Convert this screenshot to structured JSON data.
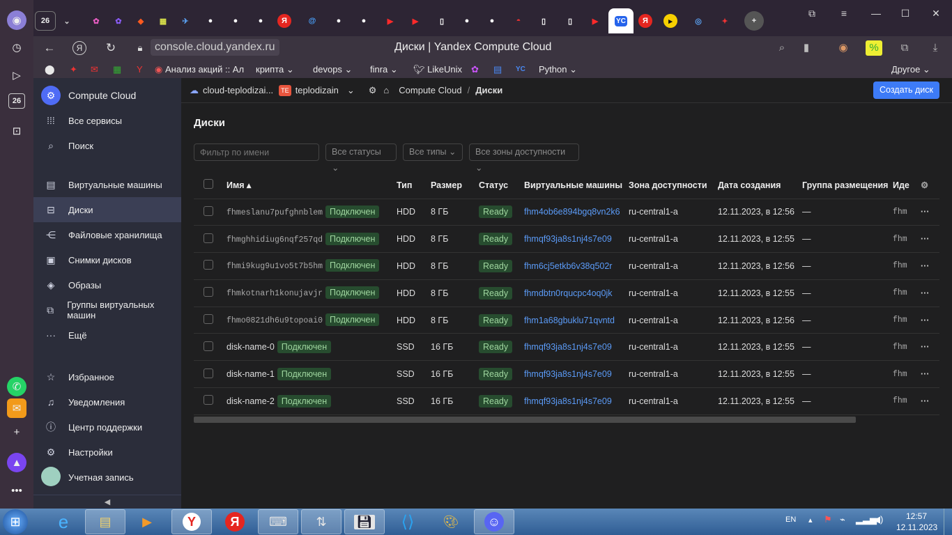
{
  "browser": {
    "tab_count": "26",
    "active_tab_label": "YC",
    "url": "console.cloud.yandex.ru",
    "page_title": "Диски | Yandex Compute Cloud",
    "bookmarks": [
      "Анализ акций :: Ал",
      "крипта",
      "devops",
      "finra",
      "LikeUnix",
      "Python",
      "Другое"
    ]
  },
  "left_strip": {
    "counter": "26"
  },
  "sidebar": {
    "product": "Compute Cloud",
    "all_services": "Все сервисы",
    "search": "Поиск",
    "items": [
      {
        "label": "Виртуальные машины"
      },
      {
        "label": "Диски"
      },
      {
        "label": "Файловые хранилища"
      },
      {
        "label": "Снимки дисков"
      },
      {
        "label": "Образы"
      },
      {
        "label": "Группы виртуальных машин"
      },
      {
        "label": "Ещё"
      }
    ],
    "bottom": [
      {
        "label": "Избранное"
      },
      {
        "label": "Уведомления"
      },
      {
        "label": "Центр поддержки"
      },
      {
        "label": "Настройки"
      },
      {
        "label": "Учетная запись"
      }
    ],
    "collapse": "◀"
  },
  "breadcrumbs": {
    "cloud": "cloud-teplodizai...",
    "folder_badge": "TE",
    "folder": "teplodizain",
    "service": "Compute Cloud",
    "sep": "/",
    "page": "Диски"
  },
  "create_button": "Создать диск",
  "page_heading": "Диски",
  "filters": {
    "name_placeholder": "Фильтр по имени",
    "statuses": "Все статусы",
    "types": "Все типы",
    "zones": "Все зоны доступности"
  },
  "table": {
    "columns": [
      "Имя ▴",
      "Тип",
      "Размер",
      "Статус",
      "Виртуальные машины",
      "Зона доступности",
      "Дата создания",
      "Группа размещения",
      "Иде"
    ],
    "rows": [
      {
        "name": "fhmeslanu7pufghnblem",
        "mono": true,
        "attached": "Подключен",
        "type": "HDD",
        "size": "8 ГБ",
        "status": "Ready",
        "vm": "fhm4ob6e894bgq8vn2k6",
        "zone": "ru-central1-a",
        "created": "12.11.2023, в 12:56",
        "group": "—",
        "id": "fhm"
      },
      {
        "name": "fhmghhidiug6nqf257qd",
        "mono": true,
        "attached": "Подключен",
        "type": "HDD",
        "size": "8 ГБ",
        "status": "Ready",
        "vm": "fhmqf93ja8s1nj4s7e09",
        "zone": "ru-central1-a",
        "created": "12.11.2023, в 12:55",
        "group": "—",
        "id": "fhm"
      },
      {
        "name": "fhmi9kug9u1vo5t7b5hm",
        "mono": true,
        "attached": "Подключен",
        "type": "HDD",
        "size": "8 ГБ",
        "status": "Ready",
        "vm": "fhm6cj5etkb6v38q502r",
        "zone": "ru-central1-a",
        "created": "12.11.2023, в 12:56",
        "group": "—",
        "id": "fhm"
      },
      {
        "name": "fhmkotnarh1konujavjr",
        "mono": true,
        "attached": "Подключен",
        "type": "HDD",
        "size": "8 ГБ",
        "status": "Ready",
        "vm": "fhmdbtn0rqucpc4oq0jk",
        "zone": "ru-central1-a",
        "created": "12.11.2023, в 12:55",
        "group": "—",
        "id": "fhm"
      },
      {
        "name": "fhmo0821dh6u9topoai0",
        "mono": true,
        "attached": "Подключен",
        "type": "HDD",
        "size": "8 ГБ",
        "status": "Ready",
        "vm": "fhm1a68gbuklu71qvntd",
        "zone": "ru-central1-a",
        "created": "12.11.2023, в 12:56",
        "group": "—",
        "id": "fhm"
      },
      {
        "name": "disk-name-0",
        "mono": false,
        "attached": "Подключен",
        "type": "SSD",
        "size": "16 ГБ",
        "status": "Ready",
        "vm": "fhmqf93ja8s1nj4s7e09",
        "zone": "ru-central1-a",
        "created": "12.11.2023, в 12:55",
        "group": "—",
        "id": "fhm"
      },
      {
        "name": "disk-name-1",
        "mono": false,
        "attached": "Подключен",
        "type": "SSD",
        "size": "16 ГБ",
        "status": "Ready",
        "vm": "fhmqf93ja8s1nj4s7e09",
        "zone": "ru-central1-a",
        "created": "12.11.2023, в 12:55",
        "group": "—",
        "id": "fhm"
      },
      {
        "name": "disk-name-2",
        "mono": false,
        "attached": "Подключен",
        "type": "SSD",
        "size": "16 ГБ",
        "status": "Ready",
        "vm": "fhmqf93ja8s1nj4s7e09",
        "zone": "ru-central1-a",
        "created": "12.11.2023, в 12:55",
        "group": "—",
        "id": "fhm"
      }
    ]
  },
  "taskbar": {
    "lang": "EN",
    "time": "12:57",
    "date": "12.11.2023"
  },
  "colors": {
    "accent": "#3d7bf7",
    "sidebar": "#2b2d3a",
    "ready_bg": "#274c2f",
    "link": "#5b9bf7"
  }
}
